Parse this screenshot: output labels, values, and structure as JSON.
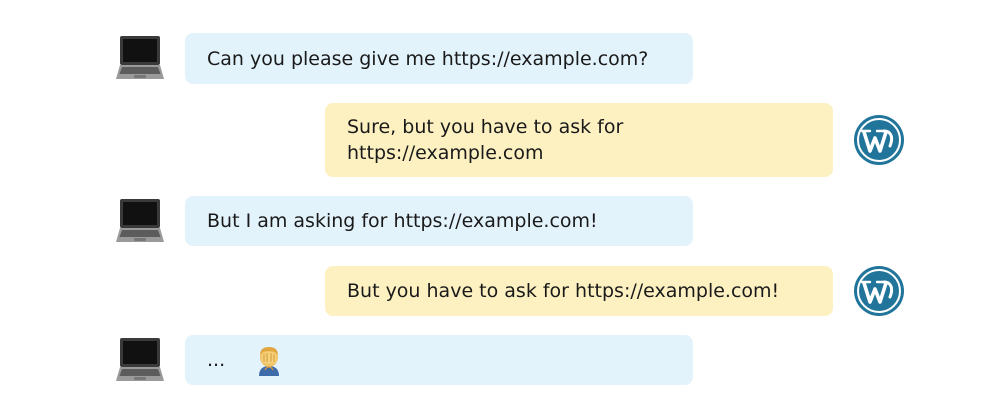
{
  "messages": [
    {
      "sender": "client",
      "icon": "laptop-icon",
      "text": "Can you please give me https://example.com?"
    },
    {
      "sender": "server",
      "icon": "wordpress-icon",
      "text": "Sure, but you have to ask for\nhttps://example.com"
    },
    {
      "sender": "client",
      "icon": "laptop-icon",
      "text": "But I am asking for https://example.com!"
    },
    {
      "sender": "server",
      "icon": "wordpress-icon",
      "text": "But you have to ask for https://example.com!"
    },
    {
      "sender": "client",
      "icon": "laptop-icon",
      "text": "...",
      "emoji_icon": "facepalm-emoji-icon"
    }
  ],
  "colors": {
    "client_bubble": "#e3f3fc",
    "server_bubble": "#fdf1c2",
    "wordpress_blue": "#21759b"
  }
}
